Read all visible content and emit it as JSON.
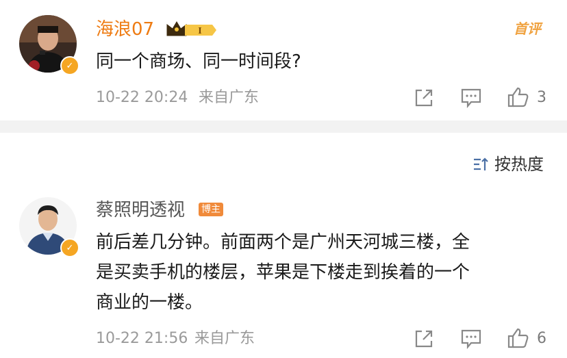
{
  "comments": [
    {
      "username": "海浪07",
      "level_badge": "I",
      "featured_label": "首评",
      "text": "同一个商场、同一时间段?",
      "time": "10-22 20:24",
      "location": "来自广东",
      "like_count": "3"
    },
    {
      "username": "蔡照明透视",
      "tag": "博主",
      "text_lines": [
        "前后差几分钟。前面两个是广州天河城三楼，全",
        "是买卖手机的楼层，苹果是下楼走到挨着的一个",
        "商业的一楼。"
      ],
      "time": "10-22 21:56",
      "location": "来自广东",
      "like_count": "6"
    }
  ],
  "sort": {
    "label": "按热度"
  },
  "icons": {
    "share": "share-icon",
    "comment": "comment-icon",
    "like": "like-icon",
    "verified": "verified-icon",
    "sort": "sort-icon",
    "crown": "crown-badge-icon"
  },
  "colors": {
    "username": "#ee7b12",
    "meta": "#9a9a9a",
    "badge": "#f5a623",
    "divider": "#f2f2f2"
  }
}
